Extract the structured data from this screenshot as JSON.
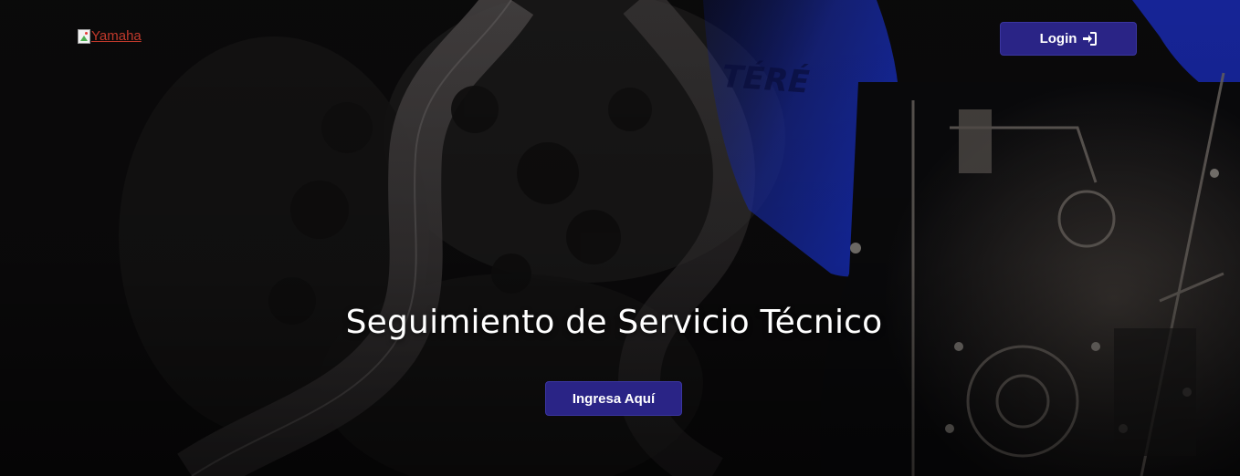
{
  "header": {
    "logo_alt": "Yamaha",
    "login_label": "Login",
    "login_icon": "sign-in-icon"
  },
  "hero": {
    "title": "Seguimiento de Servicio Técnico",
    "cta_label": "Ingresa Aquí",
    "background": "motorcycle-and-winding-road-photo"
  },
  "colors": {
    "button_bg": "#2a2486",
    "title_text": "#ffffff",
    "link_text": "#c0392b",
    "bike_accent": "#1a2a9a"
  }
}
